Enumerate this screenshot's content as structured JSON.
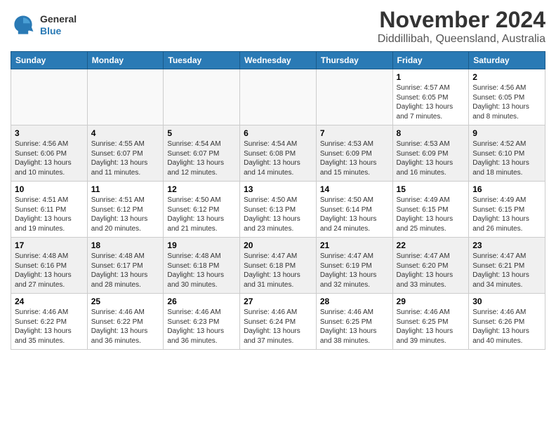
{
  "header": {
    "title": "November 2024",
    "subtitle": "Diddillibah, Queensland, Australia",
    "logo_general": "General",
    "logo_blue": "Blue"
  },
  "days_of_week": [
    "Sunday",
    "Monday",
    "Tuesday",
    "Wednesday",
    "Thursday",
    "Friday",
    "Saturday"
  ],
  "weeks": [
    [
      {
        "day": "",
        "info": ""
      },
      {
        "day": "",
        "info": ""
      },
      {
        "day": "",
        "info": ""
      },
      {
        "day": "",
        "info": ""
      },
      {
        "day": "",
        "info": ""
      },
      {
        "day": "1",
        "info": "Sunrise: 4:57 AM\nSunset: 6:05 PM\nDaylight: 13 hours and 7 minutes."
      },
      {
        "day": "2",
        "info": "Sunrise: 4:56 AM\nSunset: 6:05 PM\nDaylight: 13 hours and 8 minutes."
      }
    ],
    [
      {
        "day": "3",
        "info": "Sunrise: 4:56 AM\nSunset: 6:06 PM\nDaylight: 13 hours and 10 minutes."
      },
      {
        "day": "4",
        "info": "Sunrise: 4:55 AM\nSunset: 6:07 PM\nDaylight: 13 hours and 11 minutes."
      },
      {
        "day": "5",
        "info": "Sunrise: 4:54 AM\nSunset: 6:07 PM\nDaylight: 13 hours and 12 minutes."
      },
      {
        "day": "6",
        "info": "Sunrise: 4:54 AM\nSunset: 6:08 PM\nDaylight: 13 hours and 14 minutes."
      },
      {
        "day": "7",
        "info": "Sunrise: 4:53 AM\nSunset: 6:09 PM\nDaylight: 13 hours and 15 minutes."
      },
      {
        "day": "8",
        "info": "Sunrise: 4:53 AM\nSunset: 6:09 PM\nDaylight: 13 hours and 16 minutes."
      },
      {
        "day": "9",
        "info": "Sunrise: 4:52 AM\nSunset: 6:10 PM\nDaylight: 13 hours and 18 minutes."
      }
    ],
    [
      {
        "day": "10",
        "info": "Sunrise: 4:51 AM\nSunset: 6:11 PM\nDaylight: 13 hours and 19 minutes."
      },
      {
        "day": "11",
        "info": "Sunrise: 4:51 AM\nSunset: 6:12 PM\nDaylight: 13 hours and 20 minutes."
      },
      {
        "day": "12",
        "info": "Sunrise: 4:50 AM\nSunset: 6:12 PM\nDaylight: 13 hours and 21 minutes."
      },
      {
        "day": "13",
        "info": "Sunrise: 4:50 AM\nSunset: 6:13 PM\nDaylight: 13 hours and 23 minutes."
      },
      {
        "day": "14",
        "info": "Sunrise: 4:50 AM\nSunset: 6:14 PM\nDaylight: 13 hours and 24 minutes."
      },
      {
        "day": "15",
        "info": "Sunrise: 4:49 AM\nSunset: 6:15 PM\nDaylight: 13 hours and 25 minutes."
      },
      {
        "day": "16",
        "info": "Sunrise: 4:49 AM\nSunset: 6:15 PM\nDaylight: 13 hours and 26 minutes."
      }
    ],
    [
      {
        "day": "17",
        "info": "Sunrise: 4:48 AM\nSunset: 6:16 PM\nDaylight: 13 hours and 27 minutes."
      },
      {
        "day": "18",
        "info": "Sunrise: 4:48 AM\nSunset: 6:17 PM\nDaylight: 13 hours and 28 minutes."
      },
      {
        "day": "19",
        "info": "Sunrise: 4:48 AM\nSunset: 6:18 PM\nDaylight: 13 hours and 30 minutes."
      },
      {
        "day": "20",
        "info": "Sunrise: 4:47 AM\nSunset: 6:18 PM\nDaylight: 13 hours and 31 minutes."
      },
      {
        "day": "21",
        "info": "Sunrise: 4:47 AM\nSunset: 6:19 PM\nDaylight: 13 hours and 32 minutes."
      },
      {
        "day": "22",
        "info": "Sunrise: 4:47 AM\nSunset: 6:20 PM\nDaylight: 13 hours and 33 minutes."
      },
      {
        "day": "23",
        "info": "Sunrise: 4:47 AM\nSunset: 6:21 PM\nDaylight: 13 hours and 34 minutes."
      }
    ],
    [
      {
        "day": "24",
        "info": "Sunrise: 4:46 AM\nSunset: 6:22 PM\nDaylight: 13 hours and 35 minutes."
      },
      {
        "day": "25",
        "info": "Sunrise: 4:46 AM\nSunset: 6:22 PM\nDaylight: 13 hours and 36 minutes."
      },
      {
        "day": "26",
        "info": "Sunrise: 4:46 AM\nSunset: 6:23 PM\nDaylight: 13 hours and 36 minutes."
      },
      {
        "day": "27",
        "info": "Sunrise: 4:46 AM\nSunset: 6:24 PM\nDaylight: 13 hours and 37 minutes."
      },
      {
        "day": "28",
        "info": "Sunrise: 4:46 AM\nSunset: 6:25 PM\nDaylight: 13 hours and 38 minutes."
      },
      {
        "day": "29",
        "info": "Sunrise: 4:46 AM\nSunset: 6:25 PM\nDaylight: 13 hours and 39 minutes."
      },
      {
        "day": "30",
        "info": "Sunrise: 4:46 AM\nSunset: 6:26 PM\nDaylight: 13 hours and 40 minutes."
      }
    ]
  ]
}
